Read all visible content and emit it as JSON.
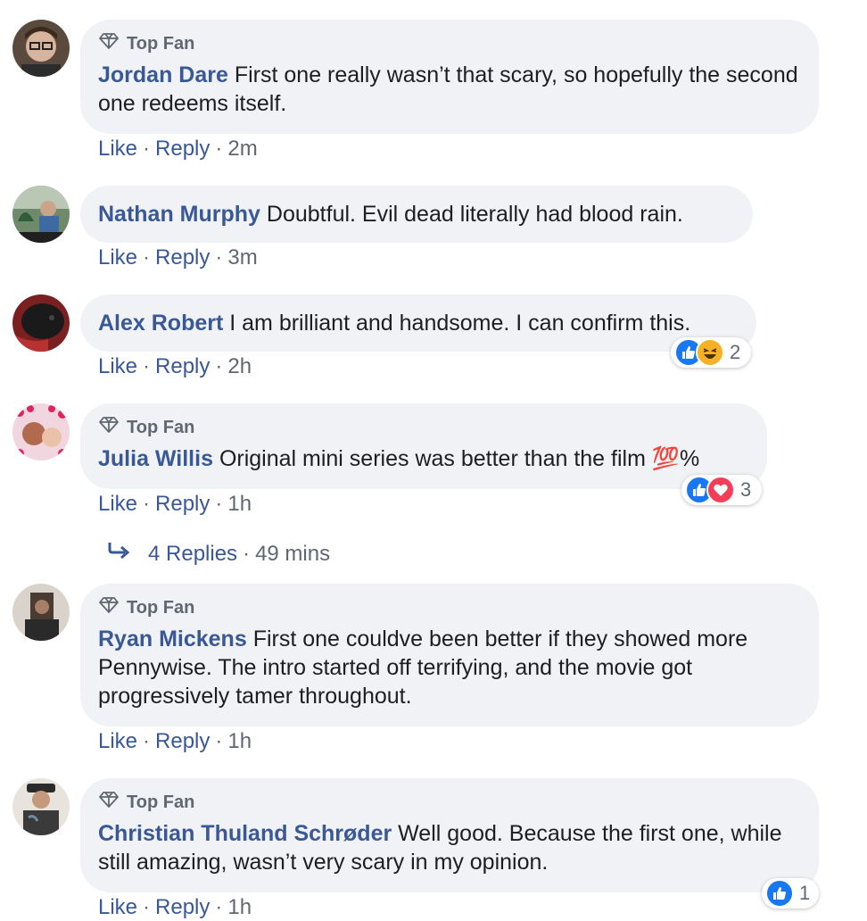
{
  "labels": {
    "top_fan": "Top Fan",
    "like": "Like",
    "reply": "Reply",
    "dot": "·"
  },
  "comments": [
    {
      "name": "Jordan Dare",
      "top_fan": true,
      "text": "First one really wasn’t that scary, so hopefully the second one redeems itself.",
      "time": "2m"
    },
    {
      "name": "Nathan Murphy",
      "top_fan": false,
      "text": "Doubtful. Evil dead literally had blood rain.",
      "time": "3m"
    },
    {
      "name": "Alex Robert",
      "top_fan": false,
      "text": "I am brilliant and handsome. I can confirm this.",
      "time": "2h",
      "reactions": {
        "icons": [
          "like-icon",
          "haha-icon"
        ],
        "count": "2"
      }
    },
    {
      "name": "Julia Willis",
      "top_fan": true,
      "text": "Original mini series was better than the film 💯%",
      "time": "1h",
      "reactions": {
        "icons": [
          "like-icon",
          "love-icon"
        ],
        "count": "3"
      }
    },
    {
      "name": "Ryan Mickens",
      "top_fan": true,
      "text": "First one couldve been better if they showed more Pennywise. The intro started off terrifying, and the movie got progressively tamer throughout.",
      "time": "1h"
    },
    {
      "name": "Christian Thuland Schrøder",
      "top_fan": true,
      "text": "Well good. Because the first one, while still amazing, wasn’t very scary in my opinion.",
      "time": "1h",
      "reactions": {
        "icons": [
          "like-icon"
        ],
        "count": "1"
      }
    }
  ],
  "replies": {
    "label": "4 Replies",
    "time": "49 mins"
  },
  "colors": {
    "name_link": "#385898",
    "bubble_bg": "#f0f2f5",
    "meta_gray": "#606770",
    "like_blue": "#1877f2",
    "love_red": "#f33e58"
  }
}
